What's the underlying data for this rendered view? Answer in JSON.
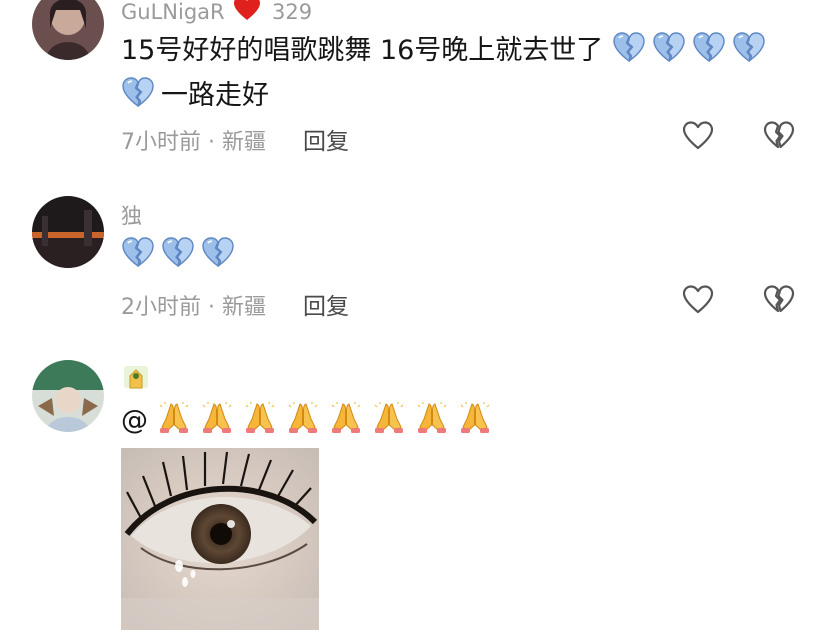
{
  "comments": [
    {
      "username": "GuLNigaR",
      "likes": "329",
      "text": "15号好好的唱歌跳舞 16号晚上就去世了",
      "text_suffix": "一路走好",
      "time": "7小时前",
      "location": "新疆",
      "reply_label": "回复",
      "emoji": "broken-heart-blue"
    },
    {
      "username": "独",
      "text": "",
      "time": "2小时前",
      "location": "新疆",
      "reply_label": "回复",
      "emoji": "broken-heart-blue"
    },
    {
      "username": "",
      "text_prefix": "@",
      "emoji": "folded-hands"
    }
  ],
  "meta_separator": "·",
  "icons": {
    "like": "heart-outline-icon",
    "dislike": "broken-heart-outline-icon",
    "colors": {
      "icon": "#555555",
      "meta": "#9a9a9a",
      "broken_heart_blue": "#8fb4e6",
      "red_heart": "#e0201c"
    }
  }
}
